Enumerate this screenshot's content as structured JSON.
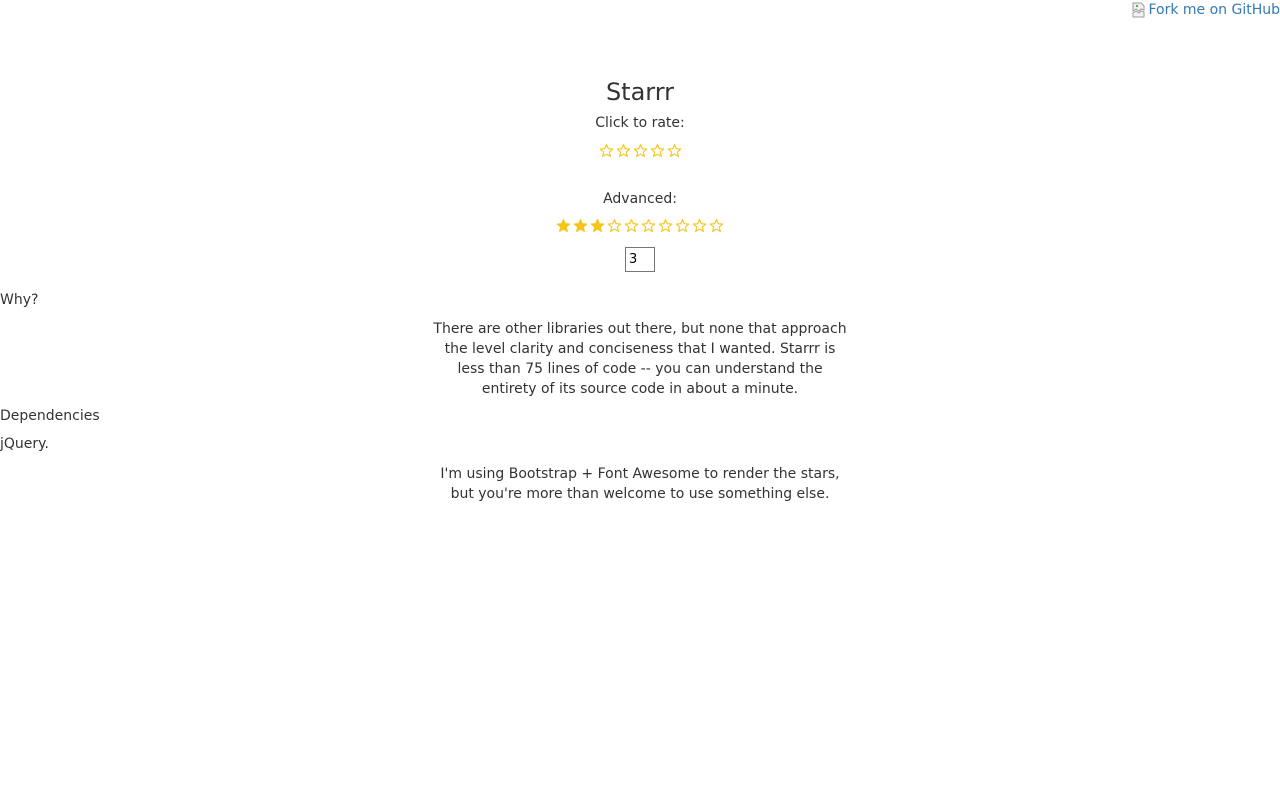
{
  "fork_ribbon": {
    "alt_text": "Fork me on GitHub"
  },
  "header": {
    "title": "Starrr"
  },
  "basic": {
    "label": "Click to rate:",
    "max_stars": 5,
    "rating": 0
  },
  "advanced": {
    "label": "Advanced:",
    "max_stars": 10,
    "rating": 3,
    "input_value": "3"
  },
  "why": {
    "heading": "Why?",
    "text": "There are other libraries out there, but none that approach the level clarity and conciseness that I wanted. Starrr is less than 75 lines of code -- you can understand the entirety of its source code in about a minute."
  },
  "dependencies": {
    "heading": "Dependencies",
    "text": "jQuery.",
    "note": "I'm using Bootstrap + Font Awesome to render the stars, but you're more than welcome to use something else."
  },
  "colors": {
    "star": "#f5c518",
    "text": "#333333",
    "link": "#337ab7"
  }
}
